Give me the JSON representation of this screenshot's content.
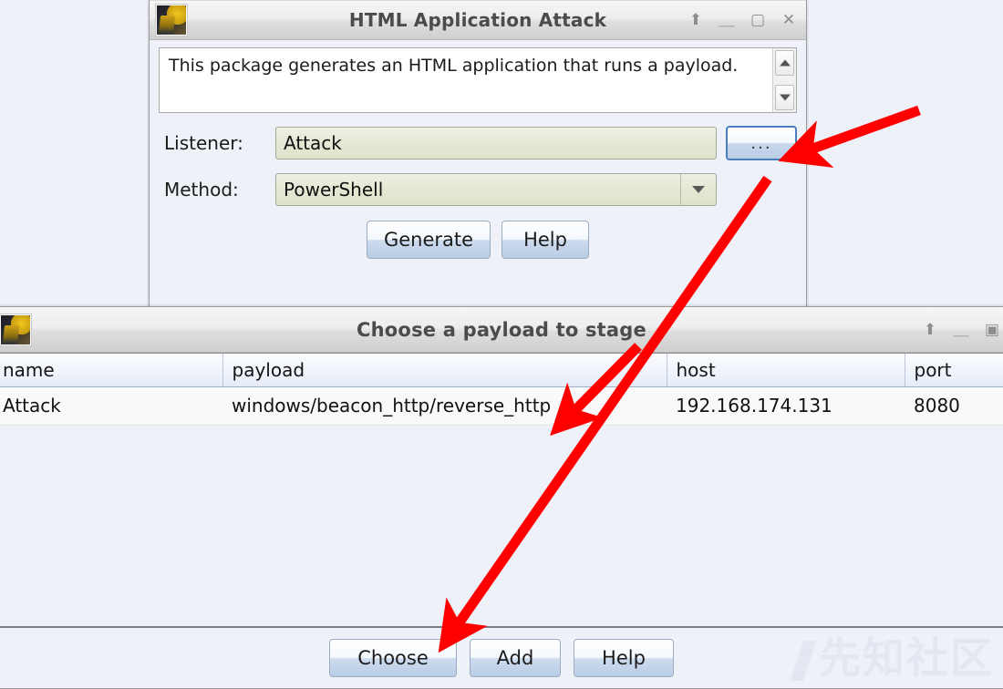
{
  "attack_window": {
    "title": "HTML Application Attack",
    "icon": "cobalt-strike-logo",
    "controls": {
      "always_on_top": "⬆",
      "minimize": "＿",
      "maximize": "▢",
      "close": "✕"
    },
    "description": "This package generates an HTML application that runs a payload.",
    "scroll": {
      "up": "▲",
      "down": "▼"
    },
    "fields": {
      "listener_label": "Listener:",
      "listener_value": "Attack",
      "browse_label": "...",
      "method_label": "Method:",
      "method_value": "PowerShell",
      "method_options": [
        "PowerShell"
      ]
    },
    "buttons": {
      "generate": "Generate",
      "help": "Help"
    }
  },
  "payload_window": {
    "title": "Choose a payload to stage",
    "icon": "cobalt-strike-logo",
    "controls": {
      "always_on_top": "⬆",
      "minimize": "＿",
      "maximize": "▣"
    },
    "table": {
      "columns": [
        "name",
        "payload",
        "host",
        "port"
      ],
      "rows": [
        {
          "name": "Attack",
          "payload": "windows/beacon_http/reverse_http",
          "host": "192.168.174.131",
          "port": "8080"
        }
      ]
    },
    "buttons": {
      "choose": "Choose",
      "add": "Add",
      "help": "Help"
    }
  },
  "watermark": {
    "text": "先知社区"
  },
  "annotations": {
    "arrow_color": "#ff0000",
    "arrow_to_browse": "points at the ... browse button",
    "arrow_to_choose": "points from the browse button down to the Choose button"
  }
}
